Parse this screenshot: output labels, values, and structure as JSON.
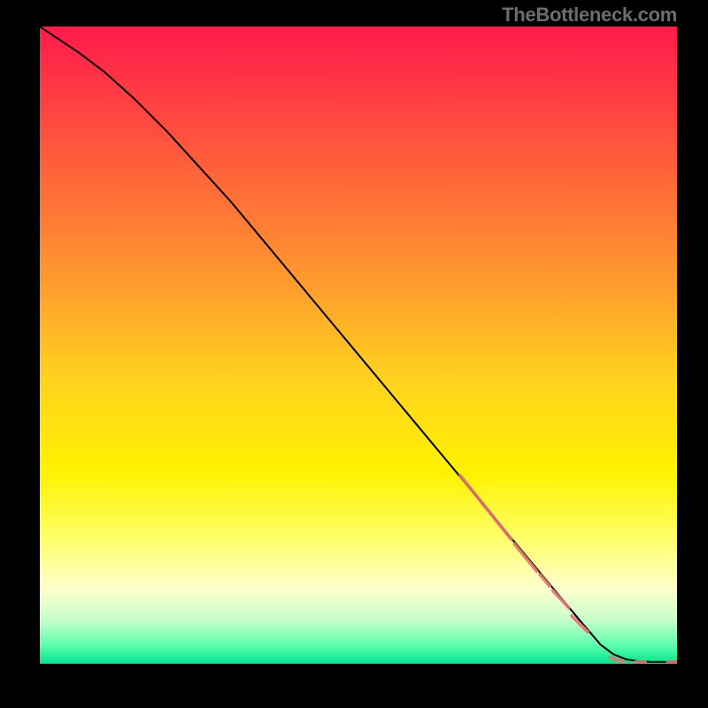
{
  "watermark": "TheBottleneck.com",
  "chart_data": {
    "type": "line",
    "title": "",
    "xlabel": "",
    "ylabel": "",
    "xlim": [
      0,
      100
    ],
    "ylim": [
      0,
      100
    ],
    "grid": false,
    "legend": null,
    "background_gradient": {
      "stops": [
        {
          "offset": 0.0,
          "color": "#ff1a4b"
        },
        {
          "offset": 0.2,
          "color": "#ff5a3c"
        },
        {
          "offset": 0.4,
          "color": "#ff9a2e"
        },
        {
          "offset": 0.55,
          "color": "#ffd21f"
        },
        {
          "offset": 0.7,
          "color": "#fff200"
        },
        {
          "offset": 0.8,
          "color": "#ffff66"
        },
        {
          "offset": 0.88,
          "color": "#ffffcc"
        },
        {
          "offset": 0.93,
          "color": "#c8ffcc"
        },
        {
          "offset": 0.97,
          "color": "#5fffac"
        },
        {
          "offset": 1.0,
          "color": "#00e58f"
        }
      ]
    },
    "series": [
      {
        "name": "curve",
        "type": "line",
        "color": "#000000",
        "x": [
          0,
          3,
          6,
          10,
          15,
          20,
          25,
          30,
          35,
          40,
          45,
          50,
          55,
          60,
          65,
          70,
          75,
          80,
          85,
          88,
          90,
          92,
          94,
          96,
          98,
          100
        ],
        "y": [
          100,
          98,
          96,
          93,
          88.5,
          83.5,
          78,
          72.5,
          66.5,
          60.5,
          54.5,
          48.5,
          42.5,
          36.5,
          30.5,
          24.5,
          18.5,
          12.5,
          6.5,
          3,
          1.5,
          0.7,
          0.4,
          0.3,
          0.3,
          0.3
        ]
      },
      {
        "name": "highlight-segments",
        "type": "segments",
        "color": "#e57373",
        "width": 3.8,
        "segments": [
          {
            "x0": 66,
            "y0": 29.5,
            "x1": 74,
            "y1": 19.5
          },
          {
            "x0": 74.5,
            "y0": 18.8,
            "x1": 78,
            "y1": 14.5
          },
          {
            "x0": 78.5,
            "y0": 14,
            "x1": 80,
            "y1": 12.2
          },
          {
            "x0": 80.5,
            "y0": 11.5,
            "x1": 83,
            "y1": 8.8
          },
          {
            "x0": 83.5,
            "y0": 7.5,
            "x1": 86,
            "y1": 5
          },
          {
            "x0": 89.5,
            "y0": 1,
            "x1": 91.5,
            "y1": 0.4
          },
          {
            "x0": 93.5,
            "y0": 0.3,
            "x1": 95,
            "y1": 0.3
          },
          {
            "x0": 98.5,
            "y0": 0.3,
            "x1": 100,
            "y1": 0.3
          }
        ]
      }
    ]
  }
}
